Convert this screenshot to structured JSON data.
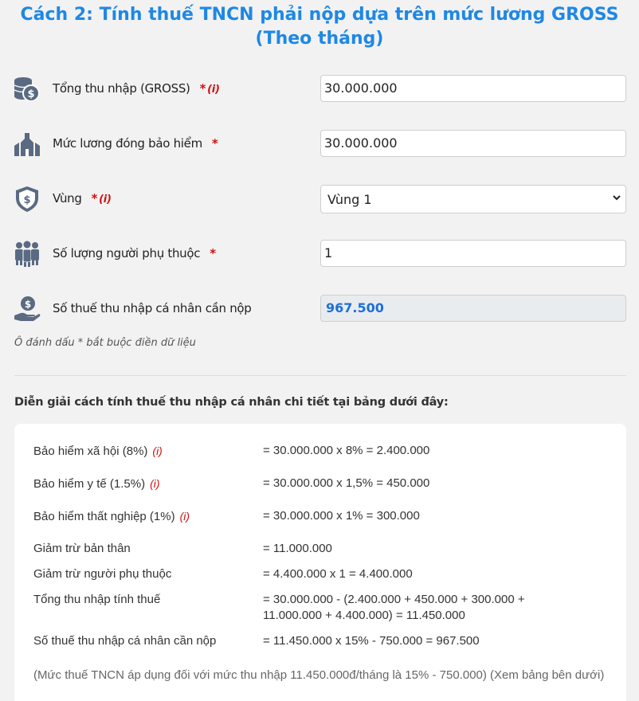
{
  "title_line1": "Cách 2: Tính thuế TNCN phải nộp dựa trên mức lương GROSS",
  "title_line2": "(Theo tháng)",
  "form": {
    "gross": {
      "label": "Tổng thu nhập (GROSS)",
      "required": "*",
      "info": "(i)",
      "value": "30.000.000",
      "icon": "coins-icon"
    },
    "insurance_salary": {
      "label": "Mức lương đóng bảo hiểm",
      "required": "*",
      "value": "30.000.000",
      "icon": "building-icon"
    },
    "region": {
      "label": "Vùng",
      "required": "*",
      "info": "(i)",
      "value": "Vùng 1",
      "icon": "shield-dollar-icon"
    },
    "dependents": {
      "label": "Số lượng người phụ thuộc",
      "required": "*",
      "value": "1",
      "icon": "people-icon"
    },
    "tax_due": {
      "label": "Số thuế thu nhập cá nhân cần nộp",
      "value": "967.500",
      "icon": "hand-dollar-icon"
    }
  },
  "required_note": "Ô đánh dấu * bắt buộc điền dữ liệu",
  "explain_heading": "Diễn giải cách tính thuế thu nhập cá nhân chi tiết tại bảng dưới đây:",
  "breakdown": [
    {
      "label": "Bảo hiểm xã hội (8%)",
      "info": "(i)",
      "value": "= 30.000.000 x 8% = 2.400.000"
    },
    {
      "label": "Bảo hiểm y tế (1.5%)",
      "info": "(i)",
      "value": "= 30.000.000 x 1,5% = 450.000"
    },
    {
      "label": "Bảo hiểm thất nghiệp (1%)",
      "info": "(i)",
      "value": "= 30.000.000 x 1% = 300.000"
    },
    {
      "label": "Giảm trừ bản thân",
      "value": "= 11.000.000"
    },
    {
      "label": "Giảm trừ người phụ thuộc",
      "value": "= 4.400.000 x 1 = 4.400.000"
    },
    {
      "label": "Tổng thu nhập tính thuế",
      "value_line1": "= 30.000.000 - (2.400.000 + 450.000 + 300.000 +",
      "value_line2": "11.000.000 + 4.400.000) = 11.450.000"
    },
    {
      "label": "Số thuế thu nhập cá nhân cần nộp",
      "value": "= 11.450.000 x 15% - 750.000 = 967.500"
    }
  ],
  "footnote": "(Mức thuế TNCN áp dụng đối với mức thu nhập 11.450.000đ/tháng là 15% - 750.000) (Xem bảng bên dưới)",
  "colors": {
    "title": "#1e88e5",
    "required": "#d01010",
    "result": "#1e6fd9",
    "icon": "#5a6a82"
  }
}
